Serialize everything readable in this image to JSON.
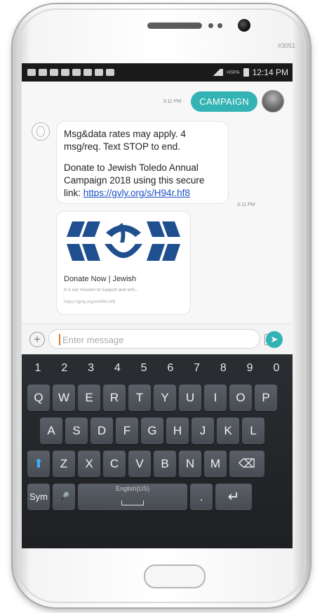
{
  "device": {
    "model_label": "#3051"
  },
  "status_bar": {
    "time": "12:14 PM",
    "network_label": "HSPA"
  },
  "conversation": {
    "outgoing": {
      "text": "CAMPAIGN",
      "time": "3:11 PM"
    },
    "incoming": {
      "line1": "Msg&data rates may apply. 4 msg/req. Text STOP to end.",
      "line2_prefix": "Donate to Jewish Toledo Annual Campaign 2018  using this secure link: ",
      "link": "https://gvly.org/s/H94r.hf8",
      "time": "3:11 PM"
    },
    "preview": {
      "title": "Donate Now | Jewish",
      "description": "It is our mission to support and enh...",
      "url": "https://gvly.org/s/H94r.hf8"
    }
  },
  "compose": {
    "placeholder": "Enter message",
    "add_label": "+",
    "send_label": "➤"
  },
  "keyboard": {
    "numbers": [
      "1",
      "2",
      "3",
      "4",
      "5",
      "6",
      "7",
      "8",
      "9",
      "0"
    ],
    "row1": [
      "Q",
      "W",
      "E",
      "R",
      "T",
      "Y",
      "U",
      "I",
      "O",
      "P"
    ],
    "row2": [
      "A",
      "S",
      "D",
      "F",
      "G",
      "H",
      "J",
      "K",
      "L"
    ],
    "row3": [
      "Z",
      "X",
      "C",
      "V",
      "B",
      "N",
      "M"
    ],
    "sym": "Sym",
    "space_label": "English(US)",
    "period": ".",
    "shift": "⬆",
    "backspace": "⌫",
    "enter": "↵",
    "mic": "🎤"
  },
  "colors": {
    "accent": "#33b3b4",
    "link": "#1a4fc5",
    "logo_blue": "#1f4f8f"
  }
}
